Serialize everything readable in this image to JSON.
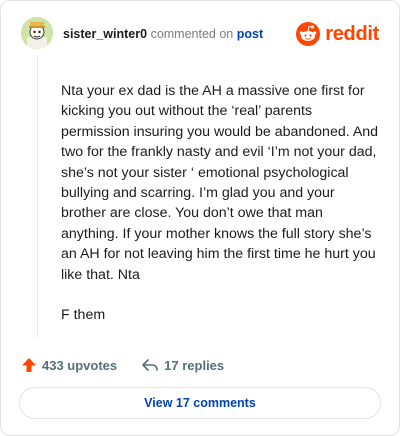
{
  "header": {
    "username": "sister_winter0",
    "commented_on": "commented on",
    "post_link": "post",
    "brand_name": "reddit"
  },
  "comment": {
    "paragraphs": [
      "Nta your ex dad is the AH a massive one first for kicking you out without the ‘real’ parents permission insuring you would be abandoned. And two for the frankly nasty and evil ‘I’m not your dad, she’s not your sister ‘ emotional psychological bullying and scarring. I’m glad you and your brother are close. You don’t owe that man anything. If your mother knows the full story she’s an AH for not leaving him the first time he hurt you like that. Nta",
      "F them"
    ]
  },
  "actions": {
    "upvotes": "433 upvotes",
    "replies": "17 replies"
  },
  "view_comments_label": "View 17 comments",
  "colors": {
    "brand": "#ff4500",
    "link": "#0045ac",
    "upvote": "#ff4500",
    "muted": "#576f76"
  },
  "icons": [
    "avatar-icon",
    "reddit-logo-icon",
    "upvote-arrow-icon",
    "reply-arrow-icon"
  ]
}
